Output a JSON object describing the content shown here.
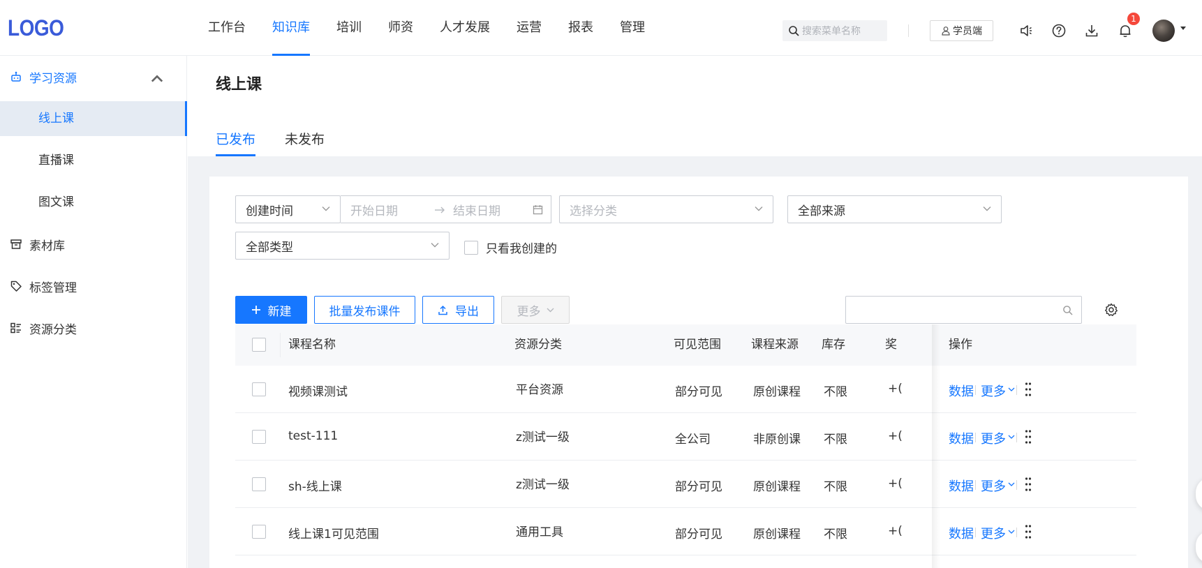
{
  "header": {
    "logo": "LOGO",
    "nav": [
      "工作台",
      "知识库",
      "培训",
      "师资",
      "人才发展",
      "运营",
      "报表",
      "管理"
    ],
    "active_nav": "知识库",
    "search_placeholder": "搜索菜单名称",
    "student_button": "学员端",
    "notification_count": "1"
  },
  "sidebar": {
    "group_learning": "学习资源",
    "sub_items": [
      "线上课",
      "直播课",
      "图文课"
    ],
    "active_sub": "线上课",
    "material": "素材库",
    "tags": "标签管理",
    "category": "资源分类"
  },
  "page": {
    "title": "线上课",
    "tabs": [
      "已发布",
      "未发布"
    ],
    "active_tab": "已发布"
  },
  "filters": {
    "time_select": "创建时间",
    "start_date_placeholder": "开始日期",
    "end_date_placeholder": "结束日期",
    "category_placeholder": "选择分类",
    "source_select": "全部来源",
    "type_select": "全部类型",
    "only_mine_label": "只看我创建的"
  },
  "toolbar": {
    "new_label": "新建",
    "batch_publish_label": "批量发布课件",
    "export_label": "导出",
    "more_label": "更多"
  },
  "table": {
    "columns": [
      "课程名称",
      "资源分类",
      "可见范围",
      "课程来源",
      "库存",
      "奖",
      "操作"
    ],
    "rows": [
      {
        "name": "视频课测试",
        "category": "平台资源",
        "visibility": "部分可见",
        "source": "原创课程",
        "stock": "不限",
        "reward": "+("
      },
      {
        "name": "test-111",
        "category": "z测试一级",
        "visibility": "全公司",
        "source": "非原创课",
        "stock": "不限",
        "reward": "+("
      },
      {
        "name": "sh-线上课",
        "category": "z测试一级",
        "visibility": "部分可见",
        "source": "原创课程",
        "stock": "不限",
        "reward": "+("
      },
      {
        "name": "线上课1可见范围",
        "category": "通用工具",
        "visibility": "部分可见",
        "source": "原创课程",
        "stock": "不限",
        "reward": "+("
      }
    ],
    "op_data": "数据",
    "op_more": "更多"
  },
  "colors": {
    "primary": "#1677ff",
    "badge": "#f5483b",
    "sidebar_active_bg": "#e5ebf3"
  }
}
